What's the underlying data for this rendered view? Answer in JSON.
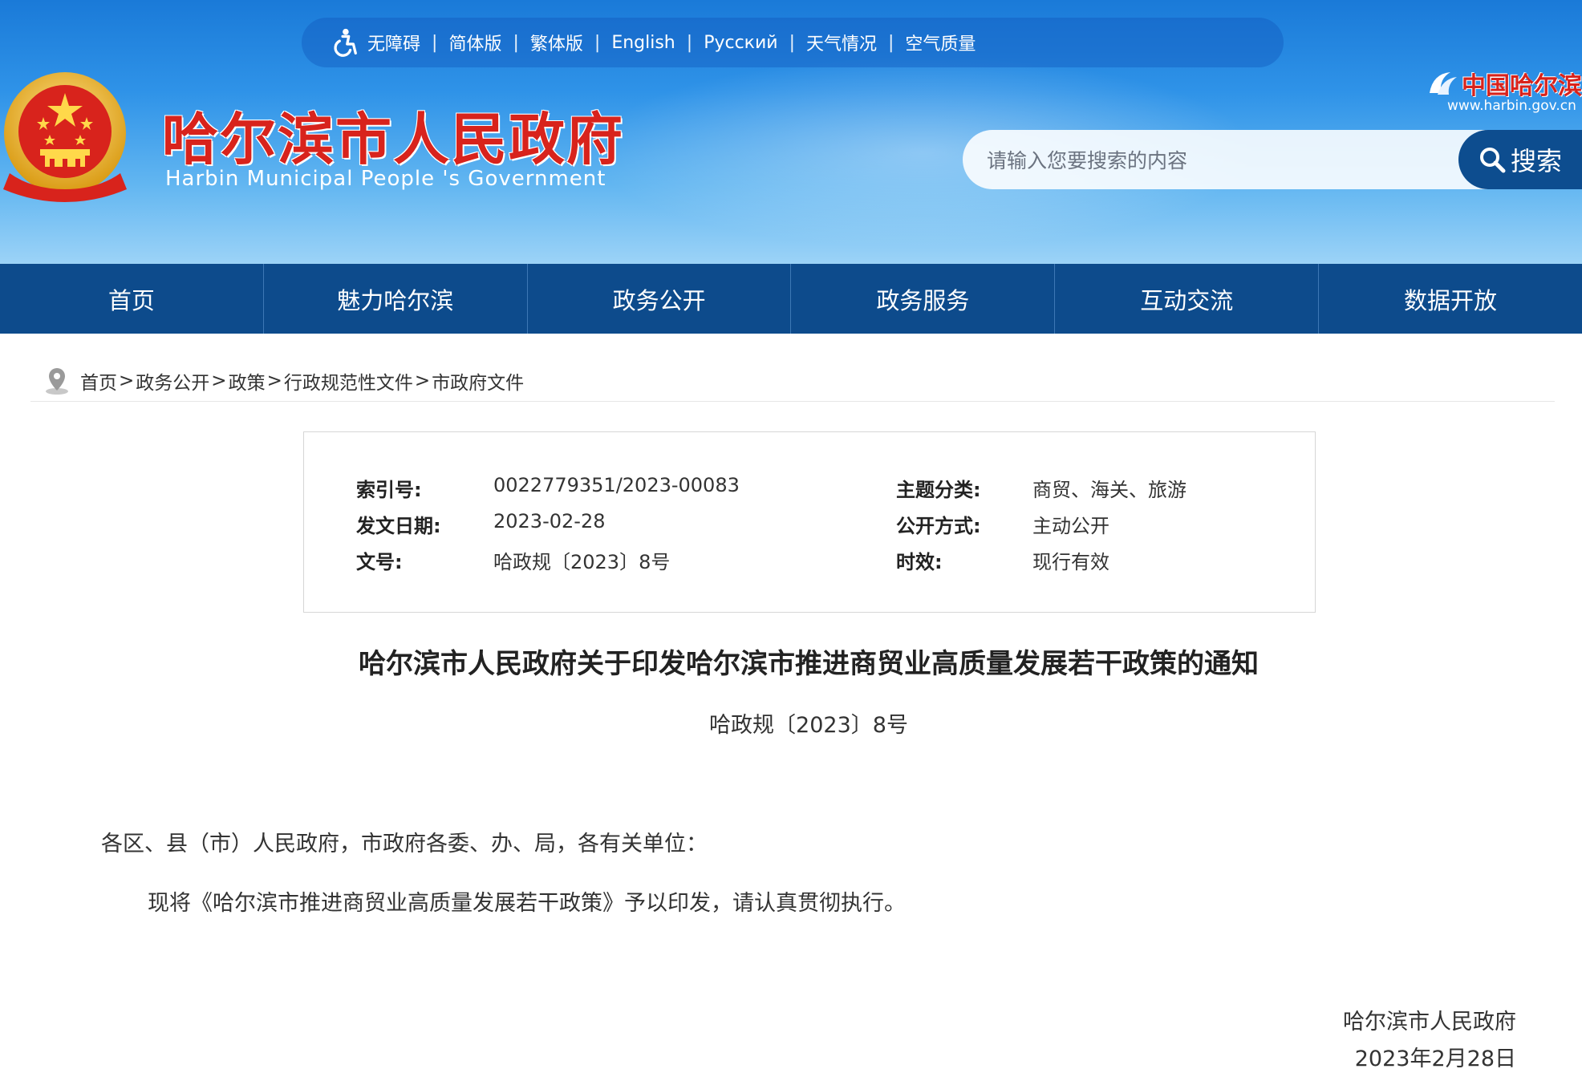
{
  "topbar": {
    "links": [
      "无障碍",
      "简体版",
      "繁体版",
      "English",
      "Русский",
      "天气情况",
      "空气质量"
    ]
  },
  "header": {
    "title_cn": "哈尔滨市人民政府",
    "title_en": "Harbin Municipal People 's Government",
    "brand_name": "中国哈尔滨",
    "brand_url": "www.harbin.gov.cn",
    "colors": {
      "title_red": "#d8231c",
      "nav_blue": "#0d4b8c"
    }
  },
  "search": {
    "placeholder": "请输入您要搜索的内容",
    "button_label": "搜索"
  },
  "nav": {
    "items": [
      "首页",
      "魅力哈尔滨",
      "政务公开",
      "政务服务",
      "互动交流",
      "数据开放"
    ]
  },
  "breadcrumb": {
    "items": [
      "首页",
      "政务公开",
      "政策",
      "行政规范性文件",
      "市政府文件"
    ],
    "separator": ">"
  },
  "info": {
    "index_label": "索引号:",
    "index_value": "0022779351/2023-00083",
    "date_label": "发文日期:",
    "date_value": "2023-02-28",
    "docno_label": "文号:",
    "docno_value": "哈政规〔2023〕8号",
    "topic_label": "主题分类:",
    "topic_value": "商贸、海关、旅游",
    "publish_label": "公开方式:",
    "publish_value": "主动公开",
    "validity_label": "时效:",
    "validity_value": "现行有效"
  },
  "article": {
    "title": "哈尔滨市人民政府关于印发哈尔滨市推进商贸业高质量发展若干政策的通知",
    "doc_no": "哈政规〔2023〕8号",
    "salutation": "各区、县（市）人民政府，市政府各委、办、局，各有关单位：",
    "body": "现将《哈尔滨市推进商贸业高质量发展若干政策》予以印发，请认真贯彻执行。",
    "signature_org": "哈尔滨市人民政府",
    "signature_date": "2023年2月28日"
  }
}
